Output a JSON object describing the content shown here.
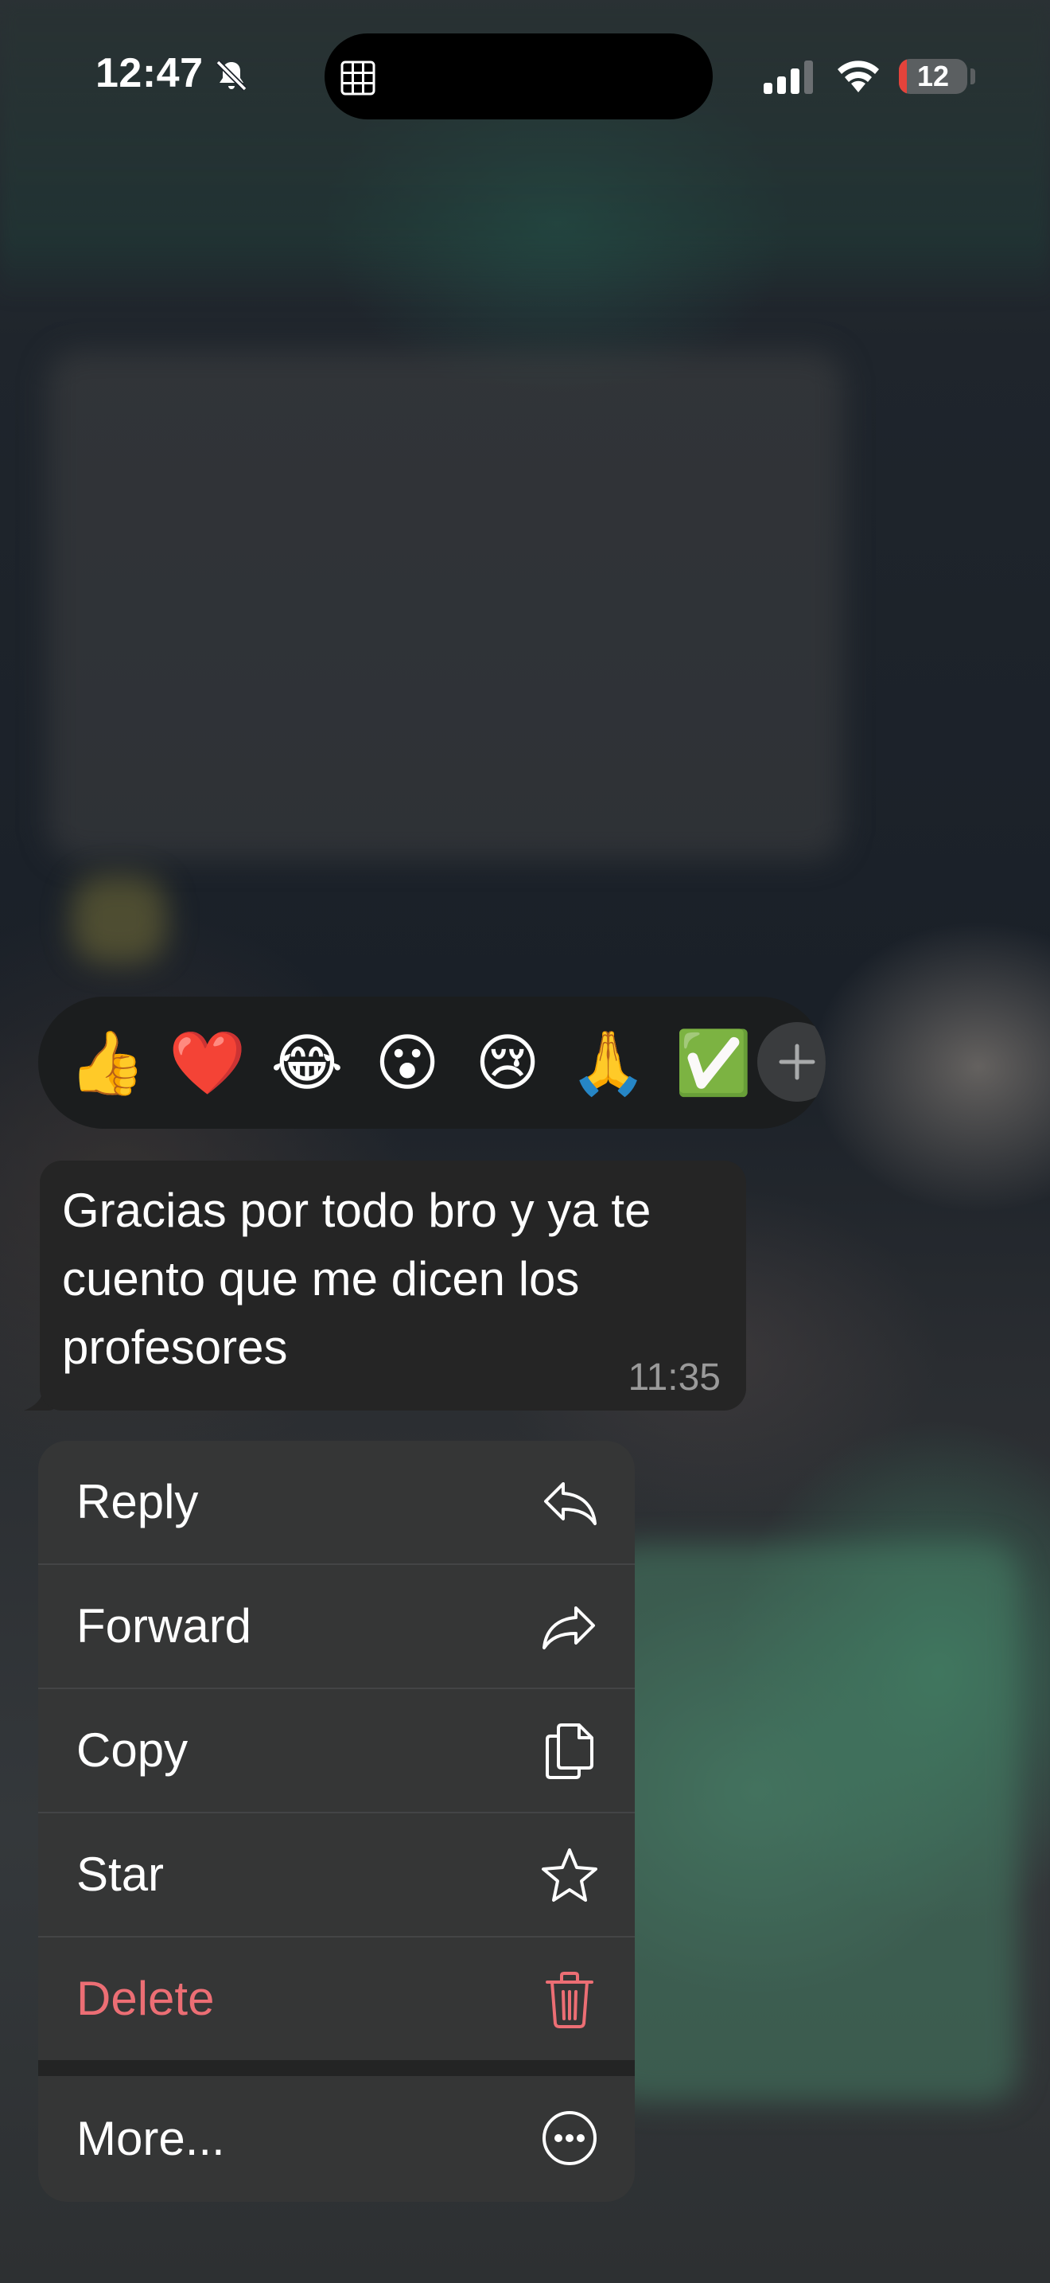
{
  "status_bar": {
    "time": "12:47",
    "battery_level": "12",
    "battery_fraction": 0.12
  },
  "reactions": [
    {
      "emoji": "👍",
      "name": "thumbs-up"
    },
    {
      "emoji": "❤️",
      "name": "red-heart"
    },
    {
      "emoji": "😂",
      "name": "tears-of-joy"
    },
    {
      "emoji": "😮",
      "name": "surprised"
    },
    {
      "emoji": "😢",
      "name": "crying"
    },
    {
      "emoji": "🙏",
      "name": "folded-hands"
    },
    {
      "emoji": "✅",
      "name": "check-mark"
    }
  ],
  "message": {
    "text": "Gracias por todo bro y ya te cuento que me dicen los profesores",
    "time": "11:35"
  },
  "menu": {
    "items": [
      {
        "label": "Reply",
        "icon": "reply-icon"
      },
      {
        "label": "Forward",
        "icon": "forward-icon"
      },
      {
        "label": "Copy",
        "icon": "copy-icon"
      },
      {
        "label": "Star",
        "icon": "star-icon"
      },
      {
        "label": "Delete",
        "icon": "trash-icon",
        "color": "#ec6e74"
      }
    ],
    "more": {
      "label": "More...",
      "icon": "more-icon"
    }
  },
  "colors": {
    "bubble": "#252525",
    "menu": "#353636",
    "delete": "#ec6e74",
    "reaction_bar": "#1b1d1e"
  }
}
